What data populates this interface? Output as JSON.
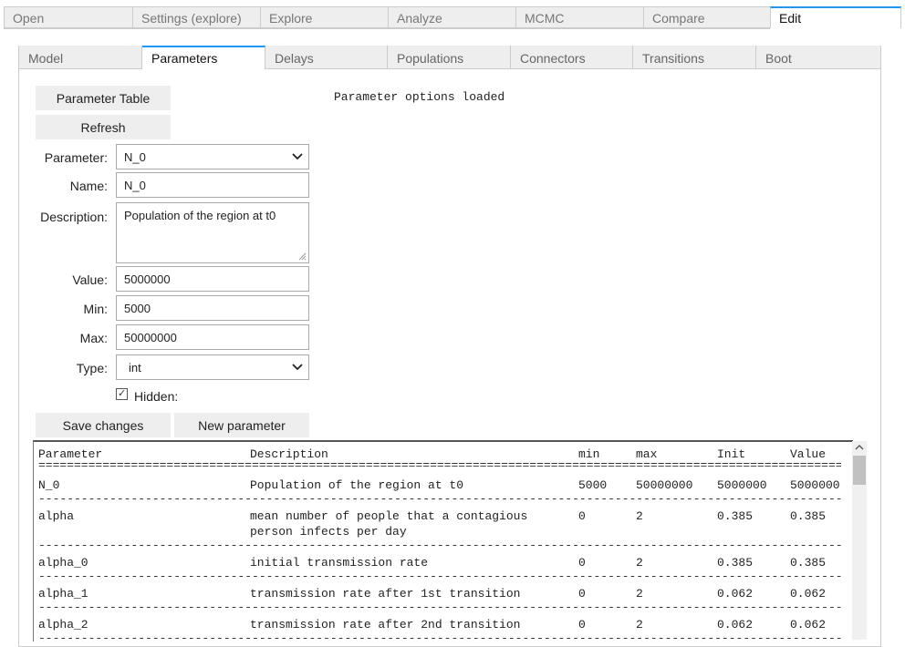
{
  "top_tabs": [
    "Open",
    "Settings (explore)",
    "Explore",
    "Analyze",
    "MCMC",
    "Compare",
    "Edit"
  ],
  "sub_tabs": [
    "Model",
    "Parameters",
    "Delays",
    "Populations",
    "Connectors",
    "Transitions",
    "Boot"
  ],
  "buttons": {
    "parameter_table": "Parameter Table",
    "refresh": "Refresh",
    "save_changes": "Save changes",
    "new_parameter": "New parameter"
  },
  "status": "Parameter options loaded",
  "form": {
    "parameter_label": "Parameter:",
    "parameter_value": "N_0",
    "name_label": "Name:",
    "name_value": "N_0",
    "description_label": "Description:",
    "description_value": "Population of the region at t0",
    "value_label": "Value:",
    "value_value": "5000000",
    "min_label": "Min:",
    "min_value": "5000",
    "max_label": "Max:",
    "max_value": "50000000",
    "type_label": "Type:",
    "type_value": "int",
    "hidden_label": "Hidden:",
    "hidden_checked": true
  },
  "table": {
    "headers": [
      "Parameter",
      "Description",
      "min",
      "max",
      "Init",
      "Value"
    ],
    "rows": [
      {
        "param": "N_0",
        "desc": "Population of the region at t0",
        "desc2": "",
        "min": "5000",
        "max": "50000000",
        "init": "5000000",
        "value": "5000000"
      },
      {
        "param": "alpha",
        "desc": "mean number of people that a contagious",
        "desc2": "person infects per day",
        "min": "0",
        "max": "2",
        "init": "0.385",
        "value": "0.385"
      },
      {
        "param": "alpha_0",
        "desc": "initial transmission rate",
        "desc2": "",
        "min": "0",
        "max": "2",
        "init": "0.385",
        "value": "0.385"
      },
      {
        "param": "alpha_1",
        "desc": "transmission rate after 1st transition",
        "desc2": "",
        "min": "0",
        "max": "2",
        "init": "0.062",
        "value": "0.062"
      },
      {
        "param": "alpha_2",
        "desc": "transmission rate after 2nd transition",
        "desc2": "",
        "min": "0",
        "max": "2",
        "init": "0.062",
        "value": "0.062"
      }
    ]
  },
  "colors": {
    "accent": "#2196f3",
    "tab_bg": "#eeeeee",
    "border": "#cccccc"
  }
}
